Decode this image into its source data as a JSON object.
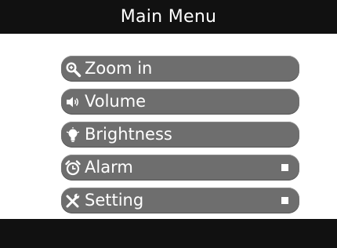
{
  "header": {
    "title": "Main Menu"
  },
  "menu": {
    "items": [
      {
        "label": "Zoom in",
        "icon": "magnifier-icon",
        "marker": false
      },
      {
        "label": "Volume",
        "icon": "speaker-icon",
        "marker": false
      },
      {
        "label": "Brightness",
        "icon": "bulb-icon",
        "marker": false
      },
      {
        "label": "Alarm",
        "icon": "alarm-clock-icon",
        "marker": true
      },
      {
        "label": "Setting",
        "icon": "tools-icon",
        "marker": true
      }
    ]
  },
  "colors": {
    "bar": "#111111",
    "item_background": "#6e6e6e",
    "text": "#ffffff"
  }
}
